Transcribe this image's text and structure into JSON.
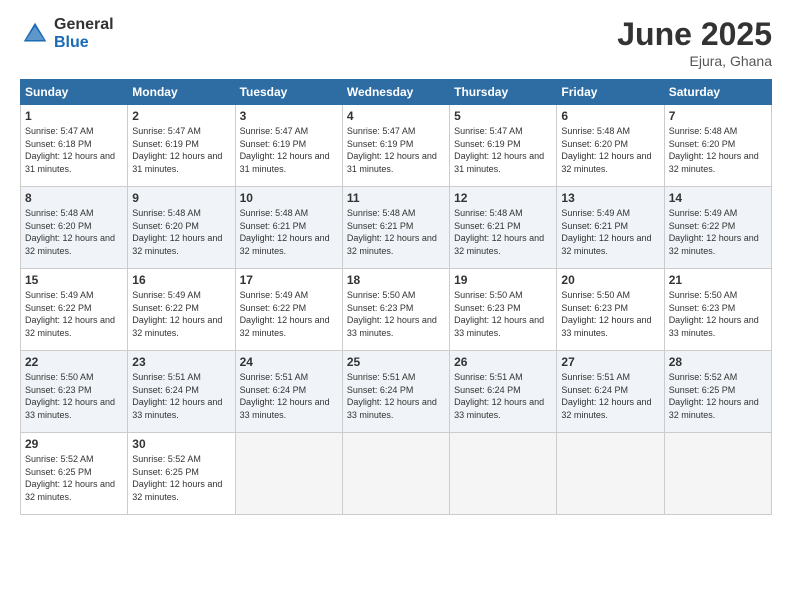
{
  "logo": {
    "general": "General",
    "blue": "Blue"
  },
  "title": "June 2025",
  "location": "Ejura, Ghana",
  "days_header": [
    "Sunday",
    "Monday",
    "Tuesday",
    "Wednesday",
    "Thursday",
    "Friday",
    "Saturday"
  ],
  "weeks": [
    [
      {
        "day": "1",
        "sunrise": "5:47 AM",
        "sunset": "6:18 PM",
        "daylight": "12 hours and 31 minutes."
      },
      {
        "day": "2",
        "sunrise": "5:47 AM",
        "sunset": "6:19 PM",
        "daylight": "12 hours and 31 minutes."
      },
      {
        "day": "3",
        "sunrise": "5:47 AM",
        "sunset": "6:19 PM",
        "daylight": "12 hours and 31 minutes."
      },
      {
        "day": "4",
        "sunrise": "5:47 AM",
        "sunset": "6:19 PM",
        "daylight": "12 hours and 31 minutes."
      },
      {
        "day": "5",
        "sunrise": "5:47 AM",
        "sunset": "6:19 PM",
        "daylight": "12 hours and 31 minutes."
      },
      {
        "day": "6",
        "sunrise": "5:48 AM",
        "sunset": "6:20 PM",
        "daylight": "12 hours and 32 minutes."
      },
      {
        "day": "7",
        "sunrise": "5:48 AM",
        "sunset": "6:20 PM",
        "daylight": "12 hours and 32 minutes."
      }
    ],
    [
      {
        "day": "8",
        "sunrise": "5:48 AM",
        "sunset": "6:20 PM",
        "daylight": "12 hours and 32 minutes."
      },
      {
        "day": "9",
        "sunrise": "5:48 AM",
        "sunset": "6:20 PM",
        "daylight": "12 hours and 32 minutes."
      },
      {
        "day": "10",
        "sunrise": "5:48 AM",
        "sunset": "6:21 PM",
        "daylight": "12 hours and 32 minutes."
      },
      {
        "day": "11",
        "sunrise": "5:48 AM",
        "sunset": "6:21 PM",
        "daylight": "12 hours and 32 minutes."
      },
      {
        "day": "12",
        "sunrise": "5:48 AM",
        "sunset": "6:21 PM",
        "daylight": "12 hours and 32 minutes."
      },
      {
        "day": "13",
        "sunrise": "5:49 AM",
        "sunset": "6:21 PM",
        "daylight": "12 hours and 32 minutes."
      },
      {
        "day": "14",
        "sunrise": "5:49 AM",
        "sunset": "6:22 PM",
        "daylight": "12 hours and 32 minutes."
      }
    ],
    [
      {
        "day": "15",
        "sunrise": "5:49 AM",
        "sunset": "6:22 PM",
        "daylight": "12 hours and 32 minutes."
      },
      {
        "day": "16",
        "sunrise": "5:49 AM",
        "sunset": "6:22 PM",
        "daylight": "12 hours and 32 minutes."
      },
      {
        "day": "17",
        "sunrise": "5:49 AM",
        "sunset": "6:22 PM",
        "daylight": "12 hours and 32 minutes."
      },
      {
        "day": "18",
        "sunrise": "5:50 AM",
        "sunset": "6:23 PM",
        "daylight": "12 hours and 33 minutes."
      },
      {
        "day": "19",
        "sunrise": "5:50 AM",
        "sunset": "6:23 PM",
        "daylight": "12 hours and 33 minutes."
      },
      {
        "day": "20",
        "sunrise": "5:50 AM",
        "sunset": "6:23 PM",
        "daylight": "12 hours and 33 minutes."
      },
      {
        "day": "21",
        "sunrise": "5:50 AM",
        "sunset": "6:23 PM",
        "daylight": "12 hours and 33 minutes."
      }
    ],
    [
      {
        "day": "22",
        "sunrise": "5:50 AM",
        "sunset": "6:23 PM",
        "daylight": "12 hours and 33 minutes."
      },
      {
        "day": "23",
        "sunrise": "5:51 AM",
        "sunset": "6:24 PM",
        "daylight": "12 hours and 33 minutes."
      },
      {
        "day": "24",
        "sunrise": "5:51 AM",
        "sunset": "6:24 PM",
        "daylight": "12 hours and 33 minutes."
      },
      {
        "day": "25",
        "sunrise": "5:51 AM",
        "sunset": "6:24 PM",
        "daylight": "12 hours and 33 minutes."
      },
      {
        "day": "26",
        "sunrise": "5:51 AM",
        "sunset": "6:24 PM",
        "daylight": "12 hours and 33 minutes."
      },
      {
        "day": "27",
        "sunrise": "5:51 AM",
        "sunset": "6:24 PM",
        "daylight": "12 hours and 32 minutes."
      },
      {
        "day": "28",
        "sunrise": "5:52 AM",
        "sunset": "6:25 PM",
        "daylight": "12 hours and 32 minutes."
      }
    ],
    [
      {
        "day": "29",
        "sunrise": "5:52 AM",
        "sunset": "6:25 PM",
        "daylight": "12 hours and 32 minutes."
      },
      {
        "day": "30",
        "sunrise": "5:52 AM",
        "sunset": "6:25 PM",
        "daylight": "12 hours and 32 minutes."
      },
      null,
      null,
      null,
      null,
      null
    ]
  ]
}
